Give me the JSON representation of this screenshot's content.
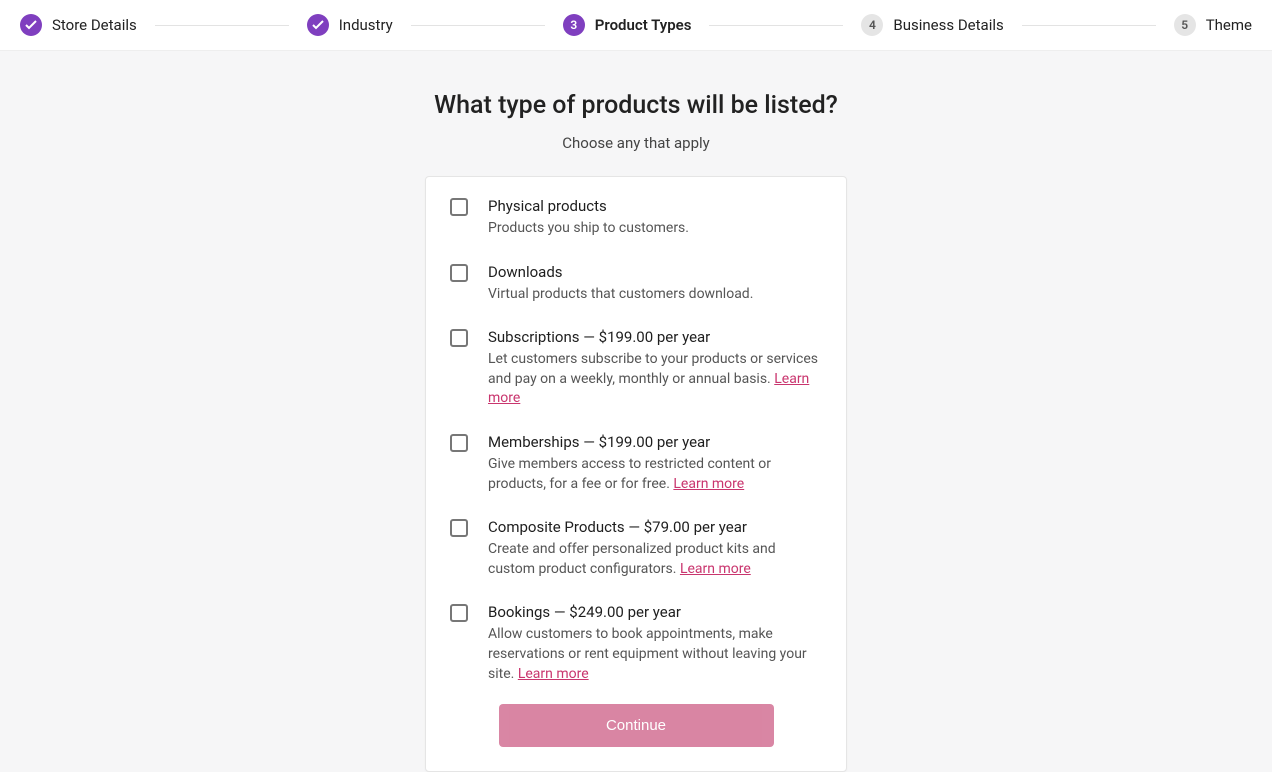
{
  "stepper": {
    "steps": [
      {
        "label": "Store Details",
        "state": "done"
      },
      {
        "label": "Industry",
        "state": "done"
      },
      {
        "label": "Product Types",
        "state": "current",
        "num": "3"
      },
      {
        "label": "Business Details",
        "state": "pending",
        "num": "4"
      },
      {
        "label": "Theme",
        "state": "pending",
        "num": "5"
      }
    ]
  },
  "main": {
    "title": "What type of products will be listed?",
    "subtitle": "Choose any that apply",
    "options": [
      {
        "title": "Physical products",
        "desc": "Products you ship to customers.",
        "learn_more": null
      },
      {
        "title": "Downloads",
        "desc": "Virtual products that customers download.",
        "learn_more": null
      },
      {
        "title": "Subscriptions — $199.00 per year",
        "desc": "Let customers subscribe to your products or services and pay on a weekly, monthly or annual basis. ",
        "learn_more": "Learn more"
      },
      {
        "title": "Memberships — $199.00 per year",
        "desc": "Give members access to restricted content or products, for a fee or for free. ",
        "learn_more": "Learn more"
      },
      {
        "title": "Composite Products — $79.00 per year",
        "desc": "Create and offer personalized product kits and custom product configurators. ",
        "learn_more": "Learn more"
      },
      {
        "title": "Bookings — $249.00 per year",
        "desc": "Allow customers to book appointments, make reservations or rent equipment without leaving your site. ",
        "learn_more": "Learn more"
      }
    ],
    "continue_label": "Continue"
  }
}
